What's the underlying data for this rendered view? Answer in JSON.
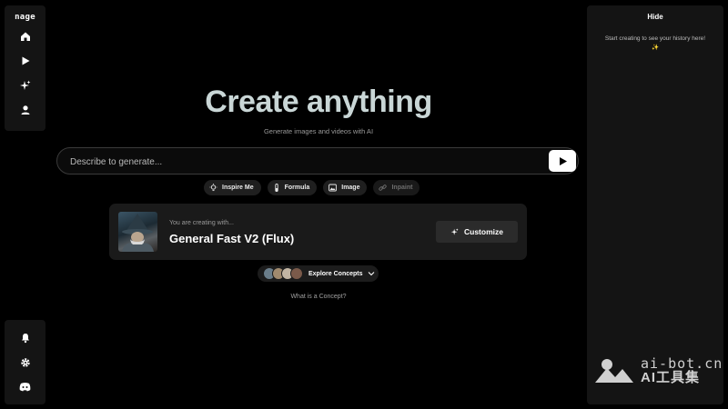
{
  "app": {
    "logo_text": "nage"
  },
  "sidebar": {
    "top_items": [
      {
        "icon": "home-icon"
      },
      {
        "icon": "play-icon"
      },
      {
        "icon": "sparkles-icon"
      },
      {
        "icon": "user-icon"
      }
    ],
    "bottom_items": [
      {
        "icon": "bell-icon"
      },
      {
        "icon": "gear-icon"
      },
      {
        "icon": "discord-icon"
      }
    ]
  },
  "history_panel": {
    "hide_label": "Hide",
    "empty_text": "Start creating to see your history here! ✨"
  },
  "hero": {
    "title": "Create anything",
    "subtitle": "Generate images and videos with AI"
  },
  "prompt": {
    "placeholder": "Describe to generate...",
    "value": ""
  },
  "chips": [
    {
      "label": "Inspire Me",
      "icon": "lightbulb-icon",
      "enabled": true
    },
    {
      "label": "Formula",
      "icon": "flask-icon",
      "enabled": true
    },
    {
      "label": "Image",
      "icon": "image-icon",
      "enabled": true
    },
    {
      "label": "Inpaint",
      "icon": "link-icon",
      "enabled": false
    }
  ],
  "model": {
    "kicker": "You are creating with...",
    "name": "General Fast V2 (Flux)",
    "customize_label": "Customize"
  },
  "concepts": {
    "label": "Explore Concepts",
    "help_link": "What is a Concept?"
  },
  "watermark": {
    "url": "ai-bot.cn",
    "cn": "AI工具集"
  },
  "colors": {
    "background": "#000000",
    "panel": "#141414",
    "title": "#c9d6d6",
    "card": "#1a1a1a"
  }
}
